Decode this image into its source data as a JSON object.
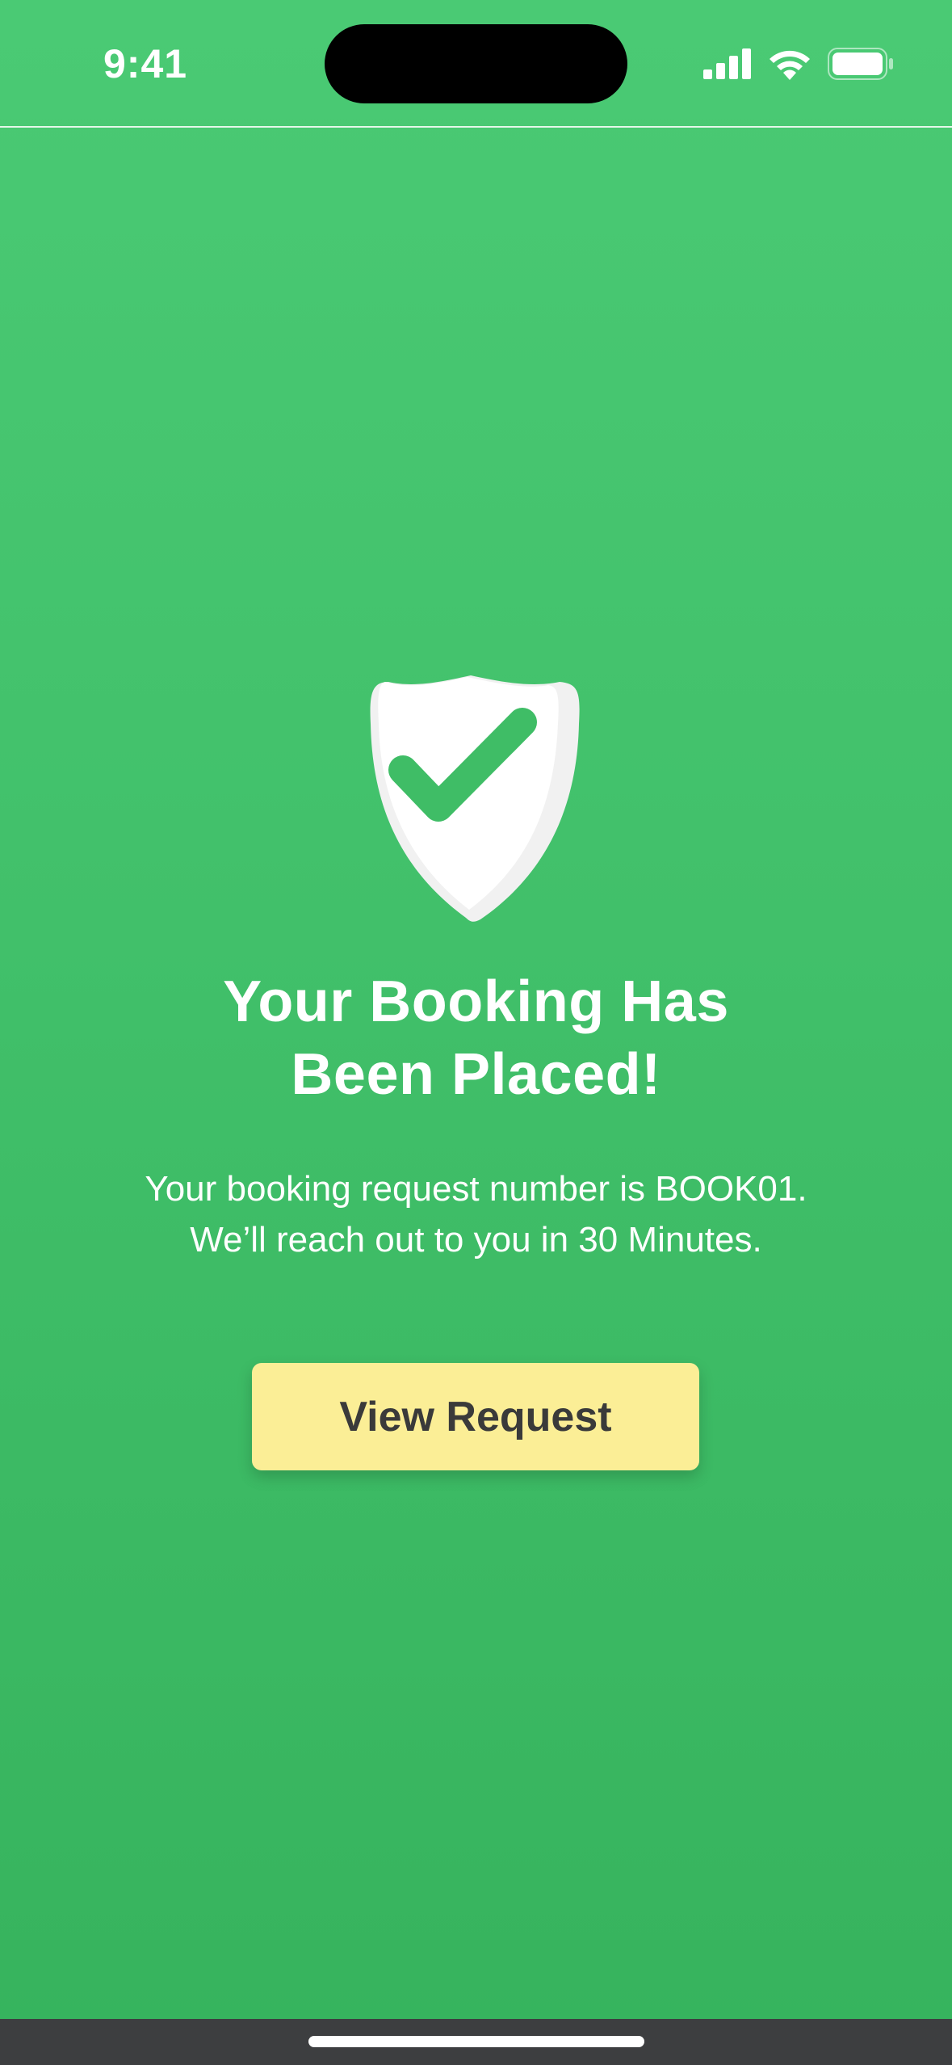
{
  "status_bar": {
    "time": "9:41",
    "signal_icon": "cellular-signal-icon",
    "wifi_icon": "wifi-icon",
    "battery_icon": "battery-icon"
  },
  "confirmation": {
    "icon": "shield-check-icon",
    "headline_line1": "Your Booking Has",
    "headline_line2": "Been Placed!",
    "message_line1": "Your booking request number is BOOK01.",
    "message_line2": "We’ll reach out to you in 30 Minutes.",
    "button_label": "View Request"
  },
  "colors": {
    "background": "#41c06a",
    "button": "#fbee96",
    "button_text": "#3a3a3a",
    "text": "#ffffff"
  }
}
